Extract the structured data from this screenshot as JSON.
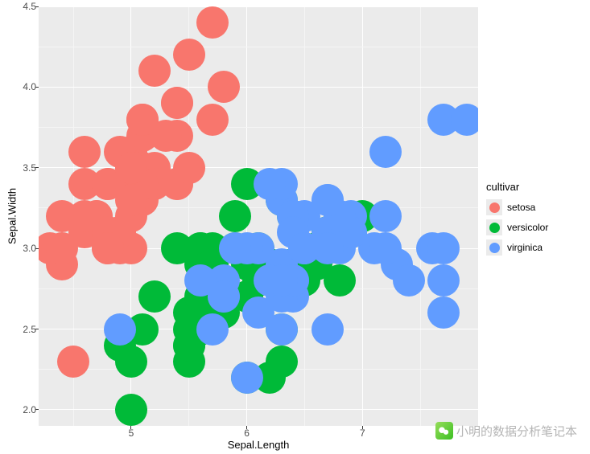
{
  "chart_data": {
    "type": "scatter",
    "title": "",
    "xlabel": "Sepal.Length",
    "ylabel": "Sepal.Width",
    "xlim": [
      4.2,
      8.0
    ],
    "ylim": [
      1.9,
      4.5
    ],
    "x_ticks": [
      5,
      6,
      7
    ],
    "y_ticks": [
      2.0,
      2.5,
      3.0,
      3.5,
      4.0,
      4.5
    ],
    "legend_title": "cultivar",
    "point_radius_px": 20,
    "series": [
      {
        "name": "setosa",
        "color": "#f8766d",
        "points": [
          [
            5.1,
            3.5
          ],
          [
            4.9,
            3.0
          ],
          [
            4.7,
            3.2
          ],
          [
            4.6,
            3.1
          ],
          [
            5.0,
            3.6
          ],
          [
            5.4,
            3.9
          ],
          [
            4.6,
            3.4
          ],
          [
            5.0,
            3.4
          ],
          [
            4.4,
            2.9
          ],
          [
            4.9,
            3.1
          ],
          [
            5.4,
            3.7
          ],
          [
            4.8,
            3.4
          ],
          [
            4.8,
            3.0
          ],
          [
            4.3,
            3.0
          ],
          [
            5.8,
            4.0
          ],
          [
            5.7,
            4.4
          ],
          [
            5.4,
            3.9
          ],
          [
            5.1,
            3.5
          ],
          [
            5.7,
            3.8
          ],
          [
            5.1,
            3.8
          ],
          [
            5.4,
            3.4
          ],
          [
            5.1,
            3.7
          ],
          [
            4.6,
            3.6
          ],
          [
            5.1,
            3.3
          ],
          [
            4.8,
            3.4
          ],
          [
            5.0,
            3.0
          ],
          [
            5.0,
            3.4
          ],
          [
            5.2,
            3.5
          ],
          [
            5.2,
            3.4
          ],
          [
            4.7,
            3.2
          ],
          [
            4.8,
            3.1
          ],
          [
            5.4,
            3.4
          ],
          [
            5.2,
            4.1
          ],
          [
            5.5,
            4.2
          ],
          [
            4.9,
            3.1
          ],
          [
            5.0,
            3.2
          ],
          [
            5.5,
            3.5
          ],
          [
            4.9,
            3.6
          ],
          [
            4.4,
            3.0
          ],
          [
            5.1,
            3.4
          ],
          [
            5.0,
            3.5
          ],
          [
            4.5,
            2.3
          ],
          [
            4.4,
            3.2
          ],
          [
            5.0,
            3.5
          ],
          [
            5.1,
            3.8
          ],
          [
            4.8,
            3.0
          ],
          [
            5.1,
            3.8
          ],
          [
            4.6,
            3.2
          ],
          [
            5.3,
            3.7
          ],
          [
            5.0,
            3.3
          ]
        ]
      },
      {
        "name": "versicolor",
        "color": "#00ba38",
        "points": [
          [
            7.0,
            3.2
          ],
          [
            6.4,
            3.2
          ],
          [
            6.9,
            3.1
          ],
          [
            5.5,
            2.3
          ],
          [
            6.5,
            2.8
          ],
          [
            5.7,
            2.8
          ],
          [
            6.3,
            3.3
          ],
          [
            4.9,
            2.4
          ],
          [
            6.6,
            2.9
          ],
          [
            5.2,
            2.7
          ],
          [
            5.0,
            2.0
          ],
          [
            5.9,
            3.0
          ],
          [
            6.0,
            2.2
          ],
          [
            6.1,
            2.9
          ],
          [
            5.6,
            2.9
          ],
          [
            6.7,
            3.1
          ],
          [
            5.6,
            3.0
          ],
          [
            5.8,
            2.7
          ],
          [
            6.2,
            2.2
          ],
          [
            5.6,
            2.5
          ],
          [
            5.9,
            3.2
          ],
          [
            6.1,
            2.8
          ],
          [
            6.3,
            2.5
          ],
          [
            6.1,
            2.8
          ],
          [
            6.4,
            2.9
          ],
          [
            6.6,
            3.0
          ],
          [
            6.8,
            2.8
          ],
          [
            6.7,
            3.0
          ],
          [
            6.0,
            2.9
          ],
          [
            5.7,
            2.6
          ],
          [
            5.5,
            2.4
          ],
          [
            5.5,
            2.4
          ],
          [
            5.8,
            2.7
          ],
          [
            6.0,
            2.7
          ],
          [
            5.4,
            3.0
          ],
          [
            6.0,
            3.4
          ],
          [
            6.7,
            3.1
          ],
          [
            6.3,
            2.3
          ],
          [
            5.6,
            3.0
          ],
          [
            5.5,
            2.5
          ],
          [
            5.5,
            2.6
          ],
          [
            6.1,
            3.0
          ],
          [
            5.8,
            2.6
          ],
          [
            5.0,
            2.3
          ],
          [
            5.6,
            2.7
          ],
          [
            5.7,
            3.0
          ],
          [
            5.7,
            2.9
          ],
          [
            6.2,
            2.9
          ],
          [
            5.1,
            2.5
          ],
          [
            5.7,
            2.8
          ]
        ]
      },
      {
        "name": "virginica",
        "color": "#619cff",
        "points": [
          [
            6.3,
            3.3
          ],
          [
            5.8,
            2.7
          ],
          [
            7.1,
            3.0
          ],
          [
            6.3,
            2.9
          ],
          [
            6.5,
            3.0
          ],
          [
            7.6,
            3.0
          ],
          [
            4.9,
            2.5
          ],
          [
            7.3,
            2.9
          ],
          [
            6.7,
            2.5
          ],
          [
            7.2,
            3.6
          ],
          [
            6.5,
            3.2
          ],
          [
            6.4,
            2.7
          ],
          [
            6.8,
            3.0
          ],
          [
            5.7,
            2.5
          ],
          [
            5.8,
            2.8
          ],
          [
            6.4,
            3.2
          ],
          [
            6.5,
            3.0
          ],
          [
            7.7,
            3.8
          ],
          [
            7.7,
            2.6
          ],
          [
            6.0,
            2.2
          ],
          [
            6.9,
            3.2
          ],
          [
            5.6,
            2.8
          ],
          [
            7.7,
            2.8
          ],
          [
            6.3,
            2.7
          ],
          [
            6.7,
            3.3
          ],
          [
            7.2,
            3.2
          ],
          [
            6.2,
            2.8
          ],
          [
            6.1,
            3.0
          ],
          [
            6.4,
            2.8
          ],
          [
            7.2,
            3.0
          ],
          [
            7.4,
            2.8
          ],
          [
            7.9,
            3.8
          ],
          [
            6.4,
            2.8
          ],
          [
            6.3,
            2.8
          ],
          [
            6.1,
            2.6
          ],
          [
            7.7,
            3.0
          ],
          [
            6.3,
            3.4
          ],
          [
            6.4,
            3.1
          ],
          [
            6.0,
            3.0
          ],
          [
            6.9,
            3.1
          ],
          [
            6.7,
            3.1
          ],
          [
            6.9,
            3.1
          ],
          [
            5.8,
            2.7
          ],
          [
            6.8,
            3.2
          ],
          [
            6.7,
            3.3
          ],
          [
            6.7,
            3.0
          ],
          [
            6.3,
            2.5
          ],
          [
            6.5,
            3.0
          ],
          [
            6.2,
            3.4
          ],
          [
            5.9,
            3.0
          ]
        ]
      }
    ]
  },
  "watermark": {
    "icon": "wechat-icon",
    "text": "小明的数据分析笔记本"
  }
}
